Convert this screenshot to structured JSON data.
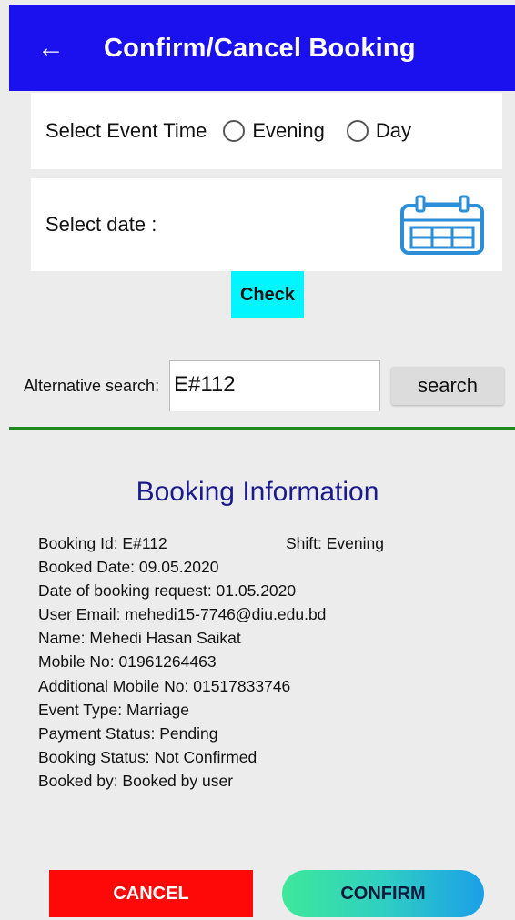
{
  "appbar": {
    "back_icon": "back-arrow-icon",
    "back_glyph": "←",
    "title": "Confirm/Cancel Booking",
    "color": "#1b10ee"
  },
  "event_time": {
    "label": "Select Event Time",
    "options": [
      "Evening",
      "Day"
    ]
  },
  "date": {
    "label": "Select date :",
    "icon": "calendar-icon"
  },
  "check_button": "Check",
  "alternative_search": {
    "label": "Alternative search:",
    "value": "E#112",
    "button": "search"
  },
  "booking": {
    "title": "Booking Information",
    "rows": [
      "Booking Id: E#112",
      "Booked Date: 09.05.2020",
      "Date of booking request: 01.05.2020",
      "User Email: mehedi15-7746@diu.edu.bd",
      "Name: Mehedi Hasan Saikat",
      "Mobile No: 01961264463",
      "Additional Mobile No: 01517833746",
      "Event Type: Marriage",
      "Payment Status: Pending",
      "Booking Status: Not Confirmed",
      "Booked by: Booked by user"
    ],
    "shift": "Shift: Evening"
  },
  "actions": {
    "cancel": "CANCEL",
    "confirm": "CONFIRM",
    "cancel_color": "#ff0808"
  }
}
